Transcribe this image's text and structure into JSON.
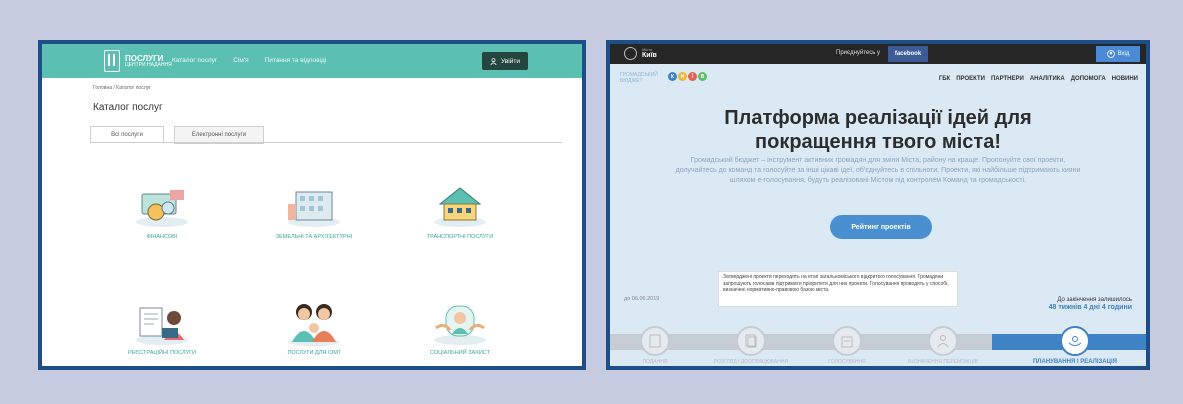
{
  "left": {
    "logo_title": "ПОСЛУГИ",
    "logo_subtitle": "ЦЕНТРИ НАДАННЯ",
    "nav": [
      "Каталог послуг",
      "Сім'я",
      "Питання та відповіді"
    ],
    "login": "Увійти",
    "breadcrumb": "Головна / Каталог послуг",
    "title": "Каталог послуг",
    "tabs": [
      "Всі послуги",
      "Електронні послуги"
    ],
    "services": [
      {
        "label": "Фінансові",
        "icon": "finance-icon"
      },
      {
        "label": "Земельні та архітектурні",
        "icon": "building-icon"
      },
      {
        "label": "Транспортні послуги",
        "icon": "house-icon"
      },
      {
        "label": "Реєстраційні послуги",
        "icon": "registration-icon"
      },
      {
        "label": "Послуги для сім'ї",
        "icon": "family-icon"
      },
      {
        "label": "Соціальний захист",
        "icon": "social-protection-icon"
      }
    ]
  },
  "right": {
    "city_small": "Місто",
    "city": "Київ",
    "join": "Приєднуйтесь у",
    "facebook": "facebook",
    "signin": "Вхід",
    "logo_small": "ГРОМАДСЬКИЙ БЮДЖЕТ",
    "logo_big": "КИЇВ",
    "nav": [
      "ГБК",
      "ПРОЕКТИ",
      "ПАРТНЕРИ",
      "АНАЛІТИКА",
      "ДОПОМОГА",
      "НОВИНИ"
    ],
    "title_line1": "Платформа реалізації ідей для",
    "title_line2": "покращення твого міста!",
    "description": "Громадський бюджет – інструмент активних громадян для зміни Міста, району на краще. Пропонуйте свої проекти, долучайтесь до команд та голосуйте за інші цікаві ідеї, об'єднуйтесь в спільноти. Проекти, які найбільше підтримають кияни шляхом е-голосування, будуть реалізовані Містом під контролем Команд та громадськості.",
    "button": "Рейтинг проектів",
    "tooltip": "Затверджені проекти переходять на етап загальноміського відкритого голосування. Громадяни запрошують голосами підтримати пріоритети для них проекти. Голосування проводять у способі, визначені нормативно-правовою базою міста.",
    "date": "до 06.06.2019",
    "deadline_label": "До закінчення залишилось",
    "deadline_value": "48 тижнів 4 дні 4 години",
    "steps": [
      {
        "label": "Подання"
      },
      {
        "label": "Розгляд і доопрацювання"
      },
      {
        "label": "Голосування"
      },
      {
        "label": "Визначення переможців"
      },
      {
        "label": "Планування і реалізація"
      }
    ]
  },
  "colors": {
    "background": "#c7cbdf",
    "frame": "#1d4f86",
    "teal_header": "#5bbfb1",
    "accent_blue": "#3f83c6"
  }
}
